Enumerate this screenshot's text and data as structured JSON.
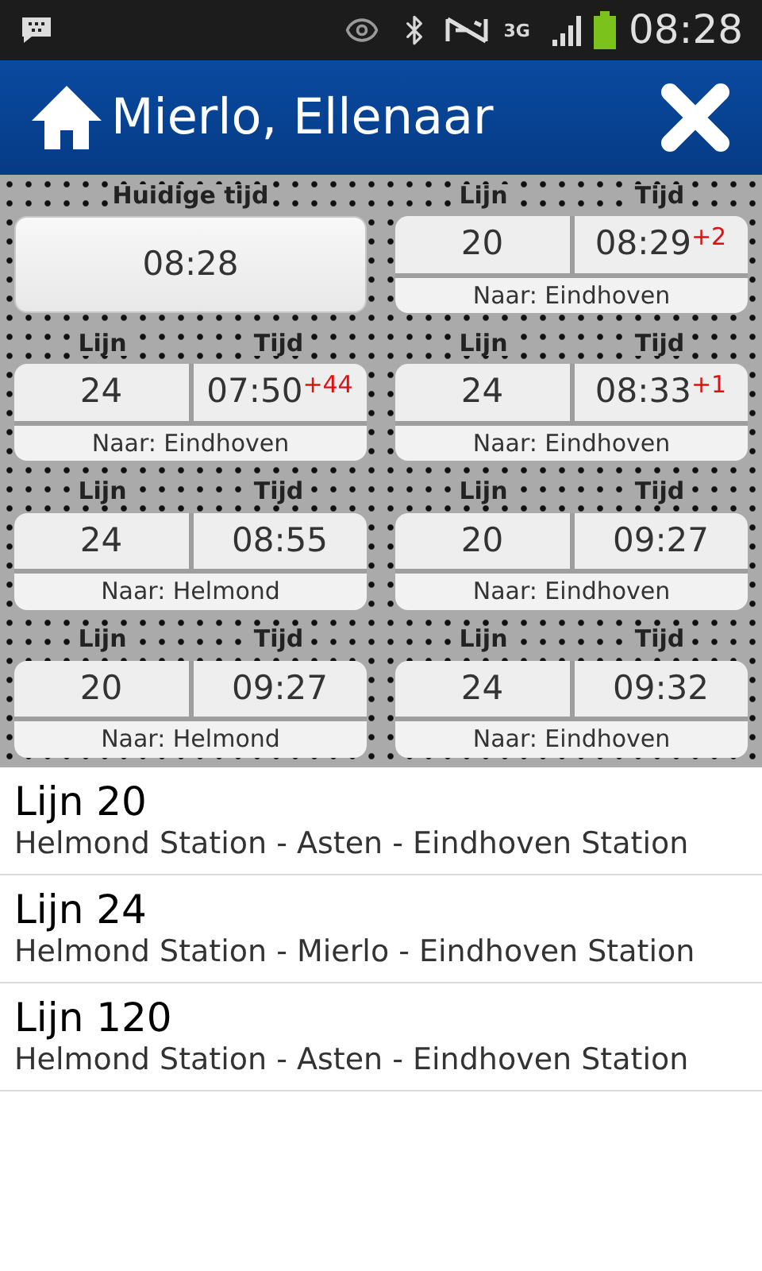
{
  "status_bar": {
    "time": "08:28",
    "network": "3G"
  },
  "header": {
    "title": "Mierlo, Ellenaar"
  },
  "current_time": {
    "label": "Huidige tijd",
    "value": "08:28"
  },
  "departures": [
    {
      "line_label": "Lijn",
      "time_label": "Tijd",
      "line": "20",
      "time": "08:29",
      "delay": "+2",
      "destination": "Naar: Eindhoven"
    },
    {
      "line_label": "Lijn",
      "time_label": "Tijd",
      "line": "24",
      "time": "07:50",
      "delay": "+44",
      "destination": "Naar: Eindhoven"
    },
    {
      "line_label": "Lijn",
      "time_label": "Tijd",
      "line": "24",
      "time": "08:33",
      "delay": "+1",
      "destination": "Naar: Eindhoven"
    },
    {
      "line_label": "Lijn",
      "time_label": "Tijd",
      "line": "24",
      "time": "08:55",
      "destination": "Naar: Helmond"
    },
    {
      "line_label": "Lijn",
      "time_label": "Tijd",
      "line": "20",
      "time": "09:27",
      "destination": "Naar: Eindhoven"
    },
    {
      "line_label": "Lijn",
      "time_label": "Tijd",
      "line": "20",
      "time": "09:27",
      "destination": "Naar: Helmond"
    },
    {
      "line_label": "Lijn",
      "time_label": "Tijd",
      "line": "24",
      "time": "09:32",
      "destination": "Naar: Eindhoven"
    }
  ],
  "routes": [
    {
      "title": "Lijn 20",
      "stops": "Helmond Station - Asten - Eindhoven Station"
    },
    {
      "title": "Lijn 24",
      "stops": "Helmond Station - Mierlo - Eindhoven Station"
    },
    {
      "title": "Lijn 120",
      "stops": "Helmond Station - Asten - Eindhoven Station"
    }
  ]
}
